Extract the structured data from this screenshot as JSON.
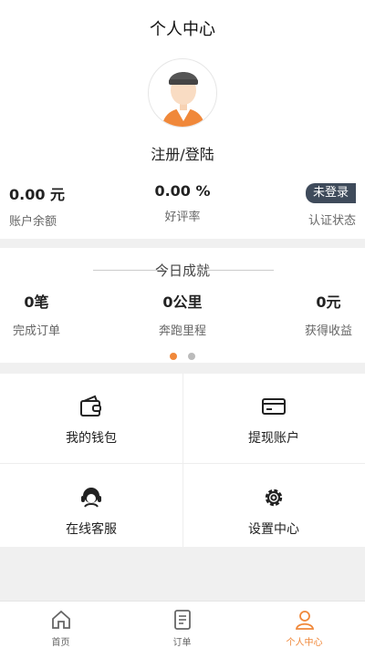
{
  "header": {
    "title": "个人中心",
    "login_label": "注册/登陆"
  },
  "stats": {
    "balance": {
      "value": "0.00 元",
      "label": "账户余额"
    },
    "rating": {
      "value": "0.00 %",
      "label": "好评率"
    },
    "auth": {
      "badge": "未登录",
      "label": "认证状态"
    }
  },
  "today": {
    "title": "今日成就",
    "orders": {
      "value": "0笔",
      "label": "完成订单"
    },
    "distance": {
      "value": "0公里",
      "label": "奔跑里程"
    },
    "income": {
      "value": "0元",
      "label": "获得收益"
    },
    "pagination": {
      "active_index": 0,
      "count": 2
    }
  },
  "menu": {
    "wallet": "我的钱包",
    "withdraw": "提现账户",
    "service": "在线客服",
    "settings": "设置中心"
  },
  "tabbar": {
    "home": "首页",
    "orders": "订单",
    "profile": "个人中心"
  },
  "colors": {
    "accent": "#f0883a",
    "badge": "#3f4b5b",
    "inactive": "#666666"
  }
}
